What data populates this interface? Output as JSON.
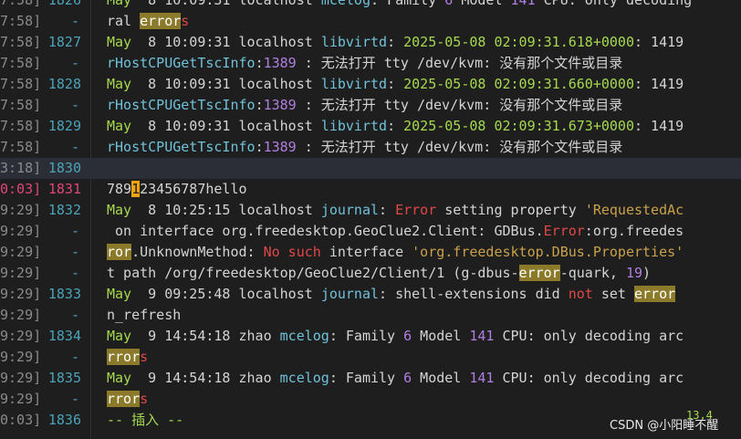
{
  "lines": [
    {
      "ts": "7:58]",
      "num": "1826",
      "text": "May  8 10:09:31 localhost mcelog: Family 6 Model 141 CPU: only decoding"
    },
    {
      "ts": "7:58]",
      "num": "-",
      "text": "ral errors"
    },
    {
      "ts": "7:58]",
      "num": "1827",
      "text": "May  8 10:09:31 localhost libvirtd: 2025-05-08 02:09:31.618+0000: 1419"
    },
    {
      "ts": "7:58]",
      "num": "-",
      "text": "rHostCPUGetTscInfo:1389 : 无法打开 tty /dev/kvm: 没有那个文件或目录"
    },
    {
      "ts": "7:58]",
      "num": "1828",
      "text": "May  8 10:09:31 localhost libvirtd: 2025-05-08 02:09:31.660+0000: 1419"
    },
    {
      "ts": "7:58]",
      "num": "-",
      "text": "rHostCPUGetTscInfo:1389 : 无法打开 tty /dev/kvm: 没有那个文件或目录"
    },
    {
      "ts": "7:58]",
      "num": "1829",
      "text": "May  8 10:09:31 localhost libvirtd: 2025-05-08 02:09:31.673+0000: 1419"
    },
    {
      "ts": "7:58]",
      "num": "-",
      "text": "rHostCPUGetTscInfo:1389 : 无法打开 tty /dev/kvm: 没有那个文件或目录"
    },
    {
      "ts": "3:18]",
      "num": "1830",
      "text": ""
    },
    {
      "ts": "0:03]",
      "num": "1831",
      "text": "789123456787hello"
    },
    {
      "ts": "9:29]",
      "num": "1832",
      "text": "May  8 10:25:15 localhost journal: Error setting property 'RequestedAc"
    },
    {
      "ts": "9:29]",
      "num": "-",
      "text": " on interface org.freedesktop.GeoClue2.Client: GDBus.Error:org.freedes"
    },
    {
      "ts": "9:29]",
      "num": "-",
      "text": "ror.UnknownMethod: No such interface 'org.freedesktop.DBus.Properties'"
    },
    {
      "ts": "9:29]",
      "num": "-",
      "text": "t path /org/freedesktop/GeoClue2/Client/1 (g-dbus-error-quark, 19)"
    },
    {
      "ts": "9:29]",
      "num": "1833",
      "text": "May  9 09:25:48 localhost journal: shell-extensions did not set error"
    },
    {
      "ts": "9:29]",
      "num": "-",
      "text": "n_refresh"
    },
    {
      "ts": "9:29]",
      "num": "1834",
      "text": "May  9 14:54:18 zhao mcelog: Family 6 Model 141 CPU: only decoding arc"
    },
    {
      "ts": "9:29]",
      "num": "-",
      "text": "rrors"
    },
    {
      "ts": "9:29]",
      "num": "1835",
      "text": "May  9 14:54:18 zhao mcelog: Family 6 Model 141 CPU: only decoding arc"
    },
    {
      "ts": "9:29]",
      "num": "-",
      "text": "rrors"
    },
    {
      "ts": "0:03]",
      "num": "1836",
      "text": "-- 插入 --"
    }
  ],
  "current_line": "1831",
  "ruler": "13,4",
  "watermark": "CSDN @小阳睡不醒",
  "colors": {
    "background": "#1e1e1e",
    "line_number": "#4aa3b8",
    "current_line_number": "#e0457b",
    "search_highlight": "#8b7a2a",
    "cursor": "#f2a311",
    "month": "#a6d94f",
    "process": "#6fc1d9",
    "number": "#b07fe0",
    "error": "#e04848",
    "string": "#c9a14a"
  }
}
